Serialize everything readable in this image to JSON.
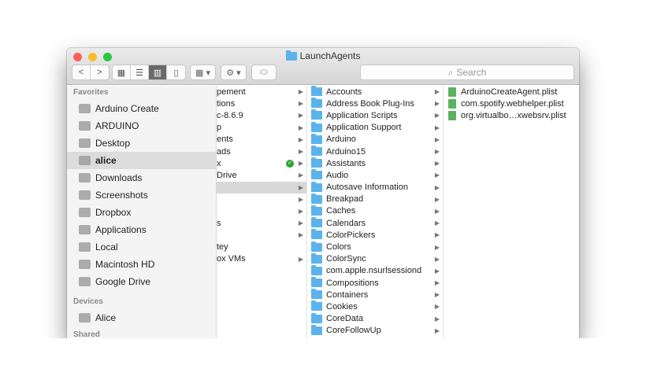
{
  "window": {
    "title": "LaunchAgents"
  },
  "toolbar": {
    "back": "<",
    "forward": ">",
    "search_placeholder": "Search"
  },
  "sidebar": {
    "favorites_header": "Favorites",
    "favorites": [
      {
        "label": "Arduino Create",
        "icon": "folder-icon"
      },
      {
        "label": "ARDUINO",
        "icon": "folder-icon"
      },
      {
        "label": "Desktop",
        "icon": "desktop-icon"
      },
      {
        "label": "alice",
        "icon": "home-icon",
        "selected": true
      },
      {
        "label": "Downloads",
        "icon": "downloads-icon"
      },
      {
        "label": "Screenshots",
        "icon": "folder-icon"
      },
      {
        "label": "Dropbox",
        "icon": "dropbox-icon"
      },
      {
        "label": "Applications",
        "icon": "applications-icon"
      },
      {
        "label": "Local",
        "icon": "folder-icon"
      },
      {
        "label": "Macintosh HD",
        "icon": "disk-icon"
      },
      {
        "label": "Google Drive",
        "icon": "folder-icon"
      }
    ],
    "devices_header": "Devices",
    "devices": [
      {
        "label": "Alice",
        "icon": "laptop-icon"
      }
    ],
    "shared_header": "Shared"
  },
  "column1": [
    {
      "label": "pement",
      "arrow": true
    },
    {
      "label": "tions",
      "arrow": true
    },
    {
      "label": "c-8.6.9",
      "arrow": true
    },
    {
      "label": "p",
      "arrow": true
    },
    {
      "label": "ents",
      "arrow": true
    },
    {
      "label": "ads",
      "arrow": true
    },
    {
      "label": "x",
      "arrow": true,
      "synced": true
    },
    {
      "label": "Drive",
      "arrow": true
    },
    {
      "label": "",
      "arrow": true,
      "selected": true
    },
    {
      "label": "",
      "arrow": true
    },
    {
      "label": "",
      "arrow": true
    },
    {
      "label": "s",
      "arrow": true
    },
    {
      "label": "",
      "arrow": true
    },
    {
      "label": "tey",
      "arrow": false
    },
    {
      "label": "ox VMs",
      "arrow": true
    }
  ],
  "column2": [
    "Accounts",
    "Address Book Plug-Ins",
    "Application Scripts",
    "Application Support",
    "Arduino",
    "Arduino15",
    "Assistants",
    "Audio",
    "Autosave Information",
    "Breakpad",
    "Caches",
    "Calendars",
    "ColorPickers",
    "Colors",
    "ColorSync",
    "com.apple.nsurlsessiond",
    "Compositions",
    "Containers",
    "Cookies",
    "CoreData",
    "CoreFollowUp"
  ],
  "column3": [
    "ArduinoCreateAgent.plist",
    "com.spotify.webhelper.plist",
    "org.virtualbo…xwebsrv.plist"
  ]
}
